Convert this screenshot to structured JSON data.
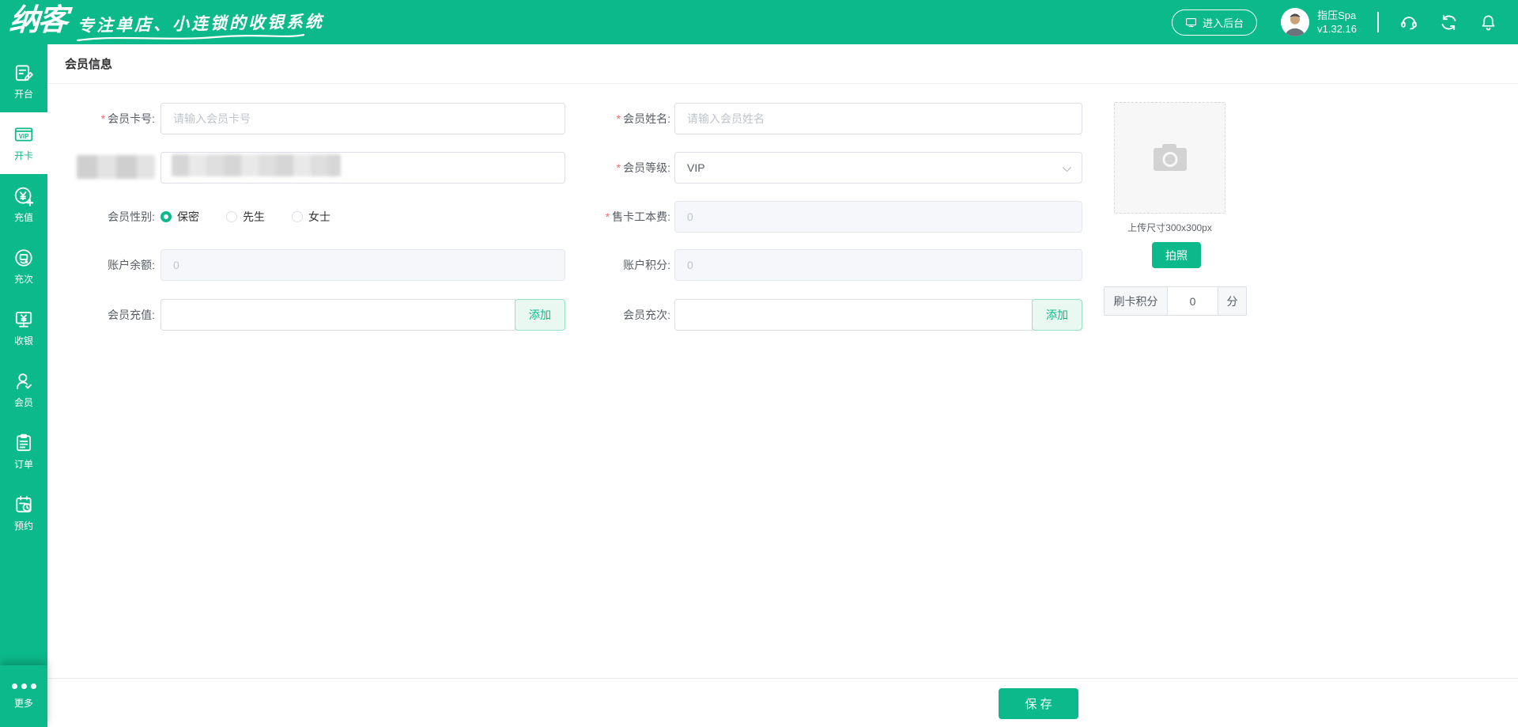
{
  "header": {
    "logo": "纳客",
    "tagline": "专注单店、小连锁的收银系统",
    "enter_backend_label": "进入后台",
    "store_name": "指压Spa",
    "version": "v1.32.16"
  },
  "sidebar": {
    "items": [
      {
        "label": "开台"
      },
      {
        "label": "开卡"
      },
      {
        "label": "充值"
      },
      {
        "label": "充次"
      },
      {
        "label": "收银"
      },
      {
        "label": "会员"
      },
      {
        "label": "订单"
      },
      {
        "label": "预约"
      }
    ],
    "more_label": "更多"
  },
  "page": {
    "title": "会员信息"
  },
  "form": {
    "required_mark": "*",
    "card_number": {
      "label": "会员卡号:",
      "placeholder": "请输入会员卡号"
    },
    "member_name": {
      "label": "会员姓名:",
      "placeholder": "请输入会员姓名"
    },
    "member_level": {
      "label": "会员等级:",
      "value": "VIP"
    },
    "gender": {
      "label": "会员性别:",
      "options": [
        "保密",
        "先生",
        "女士"
      ],
      "selected": "保密"
    },
    "card_fee": {
      "label": "售卡工本费:",
      "value": "0"
    },
    "balance": {
      "label": "账户余额:",
      "value": "0"
    },
    "points": {
      "label": "账户积分:",
      "value": "0"
    },
    "recharge": {
      "label": "会员充值:",
      "add_label": "添加"
    },
    "recharge_times": {
      "label": "会员充次:",
      "add_label": "添加"
    }
  },
  "photo": {
    "size_hint": "上传尺寸300x300px",
    "take_photo_label": "拍照",
    "swipe_points": {
      "label": "刷卡积分",
      "value": "0",
      "unit": "分"
    }
  },
  "footer": {
    "save_label": "保 存"
  },
  "colors": {
    "primary": "#0bb98a"
  }
}
